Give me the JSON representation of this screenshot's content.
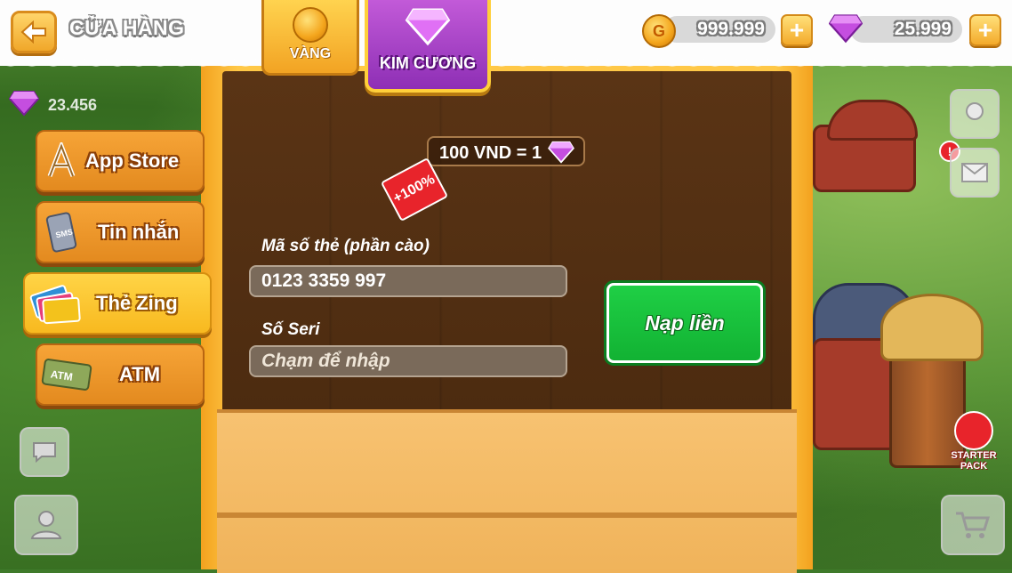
{
  "header": {
    "back_icon": "arrow-left-icon",
    "title": "CỬA HÀNG",
    "gold_amount": "999.999",
    "diamond_amount": "25.999"
  },
  "tabs": [
    {
      "label": "VÀNG",
      "icon": "gold-coin-icon",
      "active": false
    },
    {
      "label": "KIM CƯƠNG",
      "icon": "diamond-icon",
      "active": true
    }
  ],
  "background_hud": {
    "diamond_count": "23.456",
    "starter_pack": "STARTER PACK"
  },
  "side_menu": [
    {
      "label": "App Store",
      "icon": "app-store-icon",
      "active": false
    },
    {
      "label": "Tin nhắn",
      "icon": "sms-phone-icon",
      "active": false
    },
    {
      "label": "Thẻ Zing",
      "icon": "zing-card-icon",
      "active": true
    },
    {
      "label": "ATM",
      "icon": "atm-card-icon",
      "active": false
    }
  ],
  "rate": {
    "text": "100 VND = 1",
    "bonus": "+100%"
  },
  "form": {
    "card_code_label": "Mã số thẻ (phần cào)",
    "card_code_value": "0123 3359 997",
    "serial_label": "Số Seri",
    "serial_placeholder": "Chạm để nhập",
    "submit_label": "Nạp liền"
  },
  "colors": {
    "accent_orange": "#f3a21f",
    "diamond_purple": "#9b36c2",
    "button_green": "#16c13a",
    "wood_dark": "#4c2b10"
  }
}
